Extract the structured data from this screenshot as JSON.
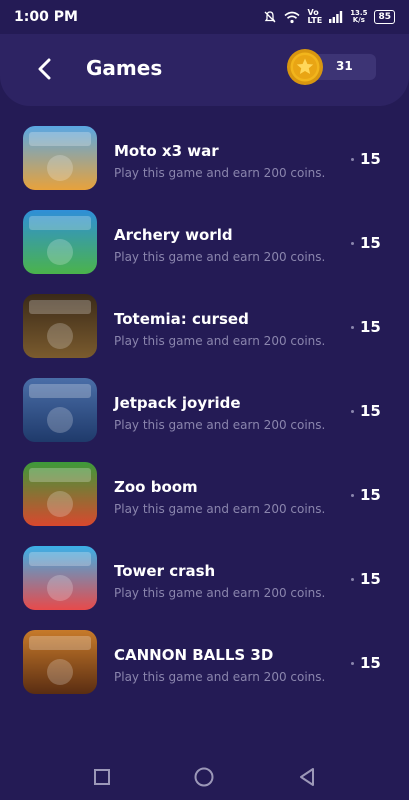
{
  "status_bar": {
    "time": "1:00 PM",
    "network_top": "Vo",
    "network_bottom": "LTE",
    "speed_top": "13.5",
    "speed_bottom": "K/s",
    "battery": "85"
  },
  "header": {
    "title": "Games",
    "coins": "31"
  },
  "games": [
    {
      "name": "Moto x3 war",
      "description": "Play this game and earn 200 coins.",
      "coins": "15",
      "thumb_colors": [
        "#5aa7e3",
        "#e8a23b"
      ]
    },
    {
      "name": "Archery world",
      "description": "Play this game and earn 200 coins.",
      "coins": "15",
      "thumb_colors": [
        "#2f8fd8",
        "#4bb34b"
      ]
    },
    {
      "name": "Totemia: cursed",
      "description": "Play this game and earn 200 coins.",
      "coins": "15",
      "thumb_colors": [
        "#3a2a18",
        "#7a5b2e"
      ]
    },
    {
      "name": "Jetpack joyride",
      "description": "Play this game and earn 200 coins.",
      "coins": "15",
      "thumb_colors": [
        "#4a6ea8",
        "#1f3a6b"
      ]
    },
    {
      "name": "Zoo boom",
      "description": "Play this game and earn 200 coins.",
      "coins": "15",
      "thumb_colors": [
        "#3d9a3a",
        "#d9482e"
      ]
    },
    {
      "name": "Tower crash",
      "description": "Play this game and earn 200 coins.",
      "coins": "15",
      "thumb_colors": [
        "#3bb0e8",
        "#e84a4a"
      ]
    },
    {
      "name": "CANNON BALLS 3D",
      "description": "Play this game and earn 200 coins.",
      "coins": "15",
      "thumb_colors": [
        "#c77a2a",
        "#5a2d12"
      ]
    }
  ],
  "colors": {
    "background": "#241b55",
    "header": "#2d2363",
    "muted_text": "#8a85ad",
    "coin": "#f2b51c"
  }
}
